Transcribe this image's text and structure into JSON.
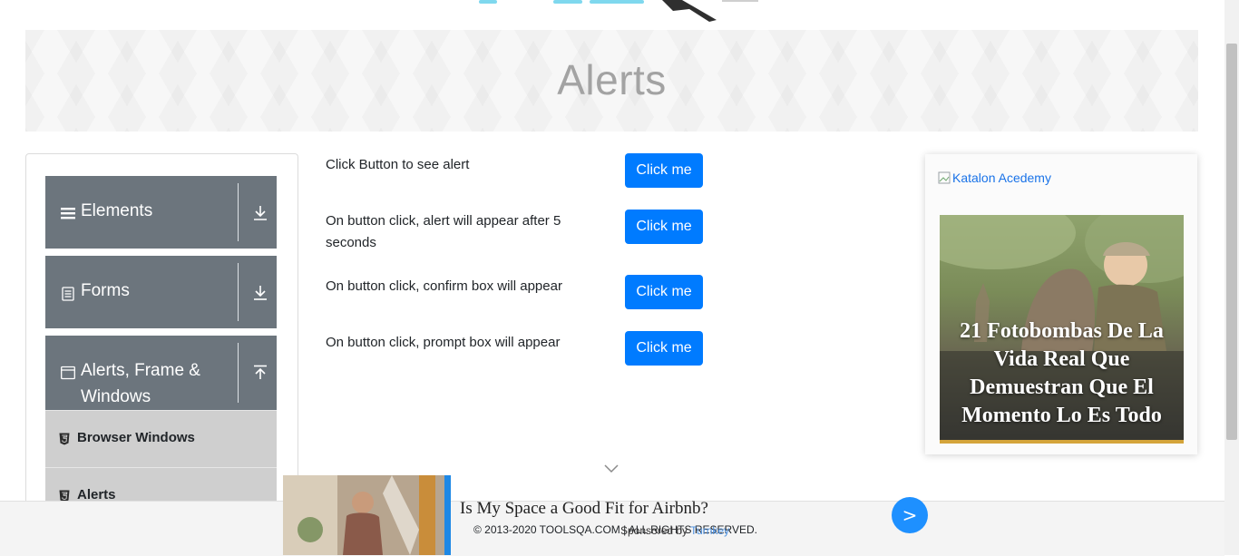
{
  "banner": {
    "title": "Alerts"
  },
  "sidebar": {
    "groups": [
      {
        "label": "Elements",
        "icon": "hamburger-icon",
        "arrow": "download-arrow-icon"
      },
      {
        "label": "Forms",
        "icon": "document-icon",
        "arrow": "download-arrow-icon"
      },
      {
        "label": "Alerts, Frame &",
        "label2": "Windows",
        "icon": "window-icon",
        "arrow": "upload-arrow-icon"
      }
    ],
    "items": [
      {
        "label": "Browser Windows",
        "icon": "html5-icon"
      },
      {
        "label": "Alerts",
        "icon": "html5-icon"
      }
    ]
  },
  "main": {
    "rows": [
      {
        "label": "Click Button to see alert",
        "button": "Click me"
      },
      {
        "label": "On button click, alert will appear after 5 seconds",
        "button": "Click me"
      },
      {
        "label": "On button click, confirm box will appear",
        "button": "Click me"
      },
      {
        "label": "On button click, prompt box will appear",
        "button": "Click me"
      }
    ]
  },
  "ad": {
    "link_text": "Katalon Acedemy",
    "headline": "21 Fotobombas De La Vida Real Que Demuestran Que El Momento Lo Es Todo"
  },
  "footer": {
    "copyright": "© 2013-2020 TOOLSQA.COM | ALL RIGHTS RESERVED."
  },
  "bottom_ad": {
    "title": "Is My Space a Good Fit for Airbnb?",
    "sponsored_prefix": "Sponsored by ",
    "sponsor": "Turnkey",
    "go_label": ">"
  },
  "colors": {
    "primary_button": "#007bff",
    "sidebar_group": "#6c757d",
    "sidebar_item": "#cfcfcf",
    "banner_title": "#a3a3a3"
  }
}
